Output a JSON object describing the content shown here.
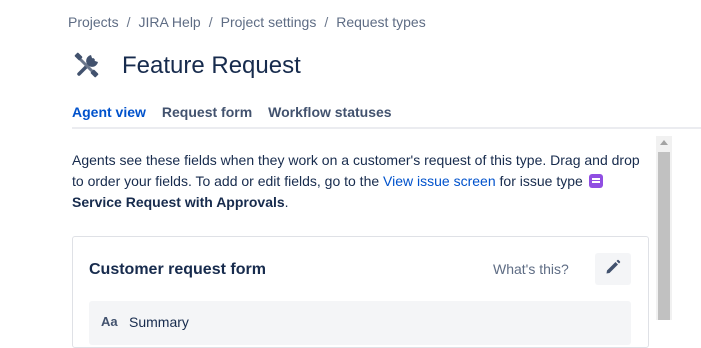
{
  "breadcrumb": {
    "items": [
      "Projects",
      "JIRA Help",
      "Project settings",
      "Request types"
    ],
    "separator": "/"
  },
  "header": {
    "icon": "tools-icon",
    "title": "Feature Request"
  },
  "tabs": [
    {
      "label": "Agent view",
      "active": true
    },
    {
      "label": "Request form",
      "active": false
    },
    {
      "label": "Workflow statuses",
      "active": false
    }
  ],
  "description": {
    "text_before_link": "Agents see these fields when they work on a customer's request of this type. Drag and drop to order your fields. To add or edit fields, go to the ",
    "link_text": "View issue screen",
    "text_after_link": " for issue type ",
    "issue_type_icon": "service-request-icon",
    "issue_type": "Service Request with Approvals",
    "period": "."
  },
  "panel": {
    "title": "Customer request form",
    "help_link": "What's this?",
    "edit_icon": "pencil-icon",
    "fields": [
      {
        "icon_text": "Aa",
        "label": "Summary"
      }
    ]
  },
  "colors": {
    "accent": "#0052cc",
    "text": "#172b4d",
    "muted": "#5e6c84",
    "issue_type_purple": "#904ee2"
  }
}
